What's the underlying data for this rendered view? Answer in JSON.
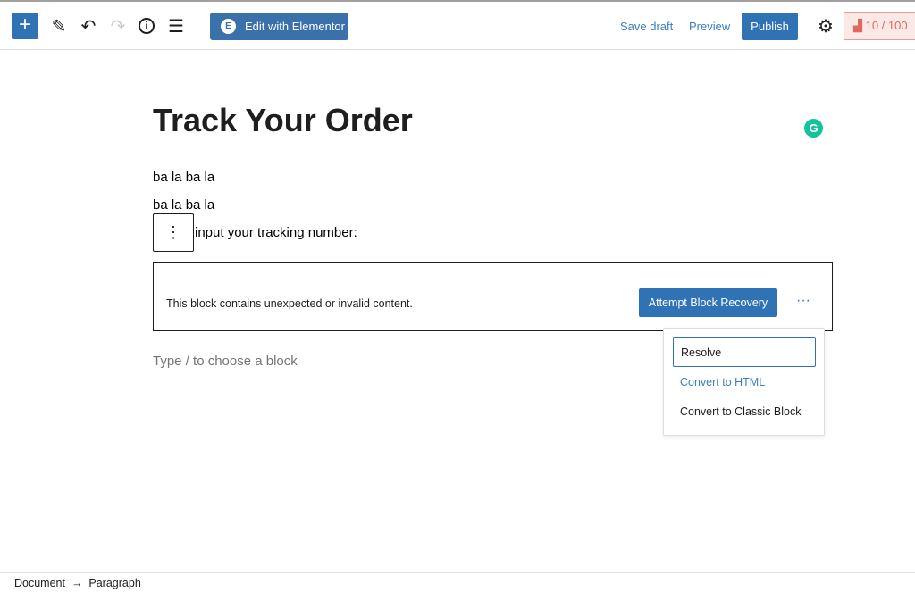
{
  "toolbar": {
    "add_icon": "plus",
    "edit_with_elementor": "Edit with Elementor",
    "save_draft": "Save draft",
    "preview": "Preview",
    "publish": "Publish",
    "score": "10 / 100",
    "accent": "#3073b5"
  },
  "content": {
    "title": "Track Your Order",
    "paragraphs": [
      "ba la ba la",
      "ba la ba la"
    ],
    "tracking_label": "input your tracking number:",
    "invalid_message": "This block contains unexpected or invalid content.",
    "attempt_recovery": "Attempt Block Recovery",
    "placeholder": "Type / to choose a block"
  },
  "menu": {
    "items": [
      "Resolve",
      "Convert to HTML",
      "Convert to Classic Block"
    ]
  },
  "breadcrumb": {
    "items": [
      "Document",
      "Paragraph"
    ]
  }
}
